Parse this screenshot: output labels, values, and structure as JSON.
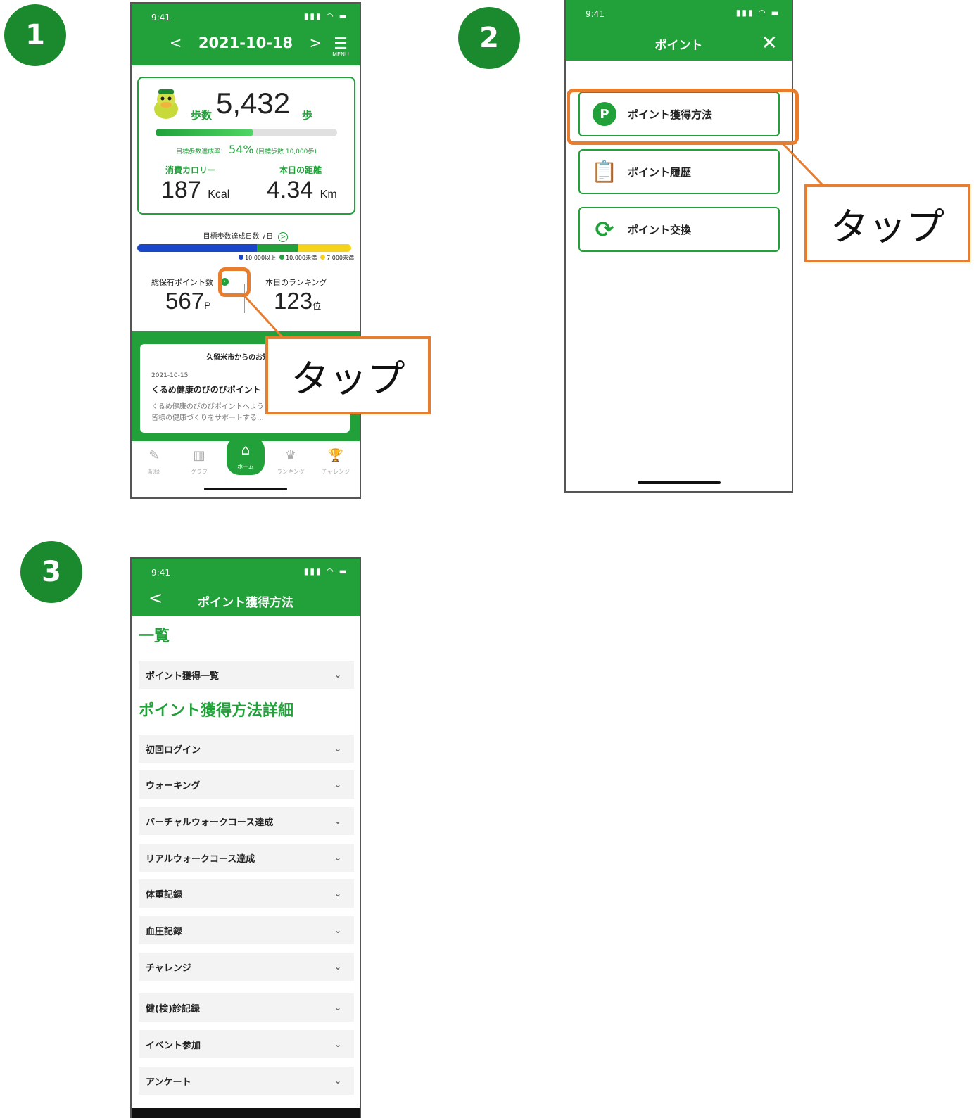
{
  "steps": [
    "1",
    "2",
    "3"
  ],
  "callout_label": "タップ",
  "colors": {
    "brand_green": "#22a13b",
    "accent_orange": "#e87d2e",
    "blue": "#1a47c9",
    "yellow": "#f5d31b",
    "dark_green": "#1b8a2f"
  },
  "phone1": {
    "status_time": "9:41",
    "status_icons": "▮▮▮ ◠ ▬",
    "header": {
      "prev": "<",
      "date": "2021-10-18",
      "next": ">",
      "menu_label": "MENU"
    },
    "steps_label": "歩数",
    "steps_value": "5,432",
    "steps_unit": "歩",
    "goal_progress": 0.54,
    "rate_label": "目標歩数達成率：",
    "rate_value": "54%",
    "rate_target": "(目標歩数 10,000歩)",
    "calorie_label": "消費カロリー",
    "calorie_value": "187",
    "calorie_unit": "Kcal",
    "distance_label": "本日の距離",
    "distance_value": "4.34",
    "distance_unit": "Km",
    "goal_days_label": "目標歩数達成日数 7日",
    "goal_days_arrow": ">",
    "goal_bar": [
      {
        "share": 0.56,
        "color": "#1a47c9"
      },
      {
        "share": 0.19,
        "color": "#22a13b"
      },
      {
        "share": 0.25,
        "color": "#f5d31b"
      }
    ],
    "legend": [
      {
        "label": "10,000以上",
        "color": "#1a47c9"
      },
      {
        "label": "10,000未満",
        "color": "#22a13b"
      },
      {
        "label": "7,000未満",
        "color": "#f5d31b"
      }
    ],
    "points_label": "総保有ポイント数",
    "points_value": "567",
    "points_unit": "P",
    "points_arrow": "›",
    "ranking_label": "本日のランキング",
    "ranking_value": "123",
    "ranking_unit": "位",
    "news_title": "久留米市からのお知らせ",
    "news_date": "2021-10-15",
    "news_headline": "くるめ健康のびのびポイント",
    "news_body": "くるめ健康のびのびポイントへようこそ！ リでは、市民の皆様の健康づくりをサポートする…",
    "tabs": [
      {
        "icon": "✎",
        "label": "記録"
      },
      {
        "icon": "▥",
        "label": "グラフ"
      },
      {
        "icon": "⌂",
        "label": "ホーム"
      },
      {
        "icon": "♛",
        "label": "ランキング"
      },
      {
        "icon": "🏆",
        "label": "チャレンジ"
      }
    ]
  },
  "phone2": {
    "status_time": "9:41",
    "status_icons": "▮▮▮ ◠ ▬",
    "title": "ポイント",
    "close": "✕",
    "buttons": [
      {
        "icon": "P",
        "icon_name": "point-p-icon",
        "label": "ポイント獲得方法"
      },
      {
        "icon": "📋",
        "icon_name": "clipboard-icon",
        "label": "ポイント履歴"
      },
      {
        "icon": "⟳",
        "icon_name": "refresh-icon",
        "label": "ポイント交換"
      }
    ]
  },
  "phone3": {
    "status_time": "9:41",
    "status_icons": "▮▮▮ ◠ ▬",
    "back": "<",
    "title": "ポイント獲得方法",
    "section1": "一覧",
    "section2": "ポイント獲得方法詳細",
    "chevron": "⌄",
    "list_item": "ポイント獲得一覧",
    "details": [
      "初回ログイン",
      "ウォーキング",
      "バーチャルウォークコース達成",
      "リアルウォークコース達成",
      "体重記録",
      "血圧記録",
      "チャレンジ",
      "健(検)診記録",
      "イベント参加",
      "アンケート"
    ]
  }
}
